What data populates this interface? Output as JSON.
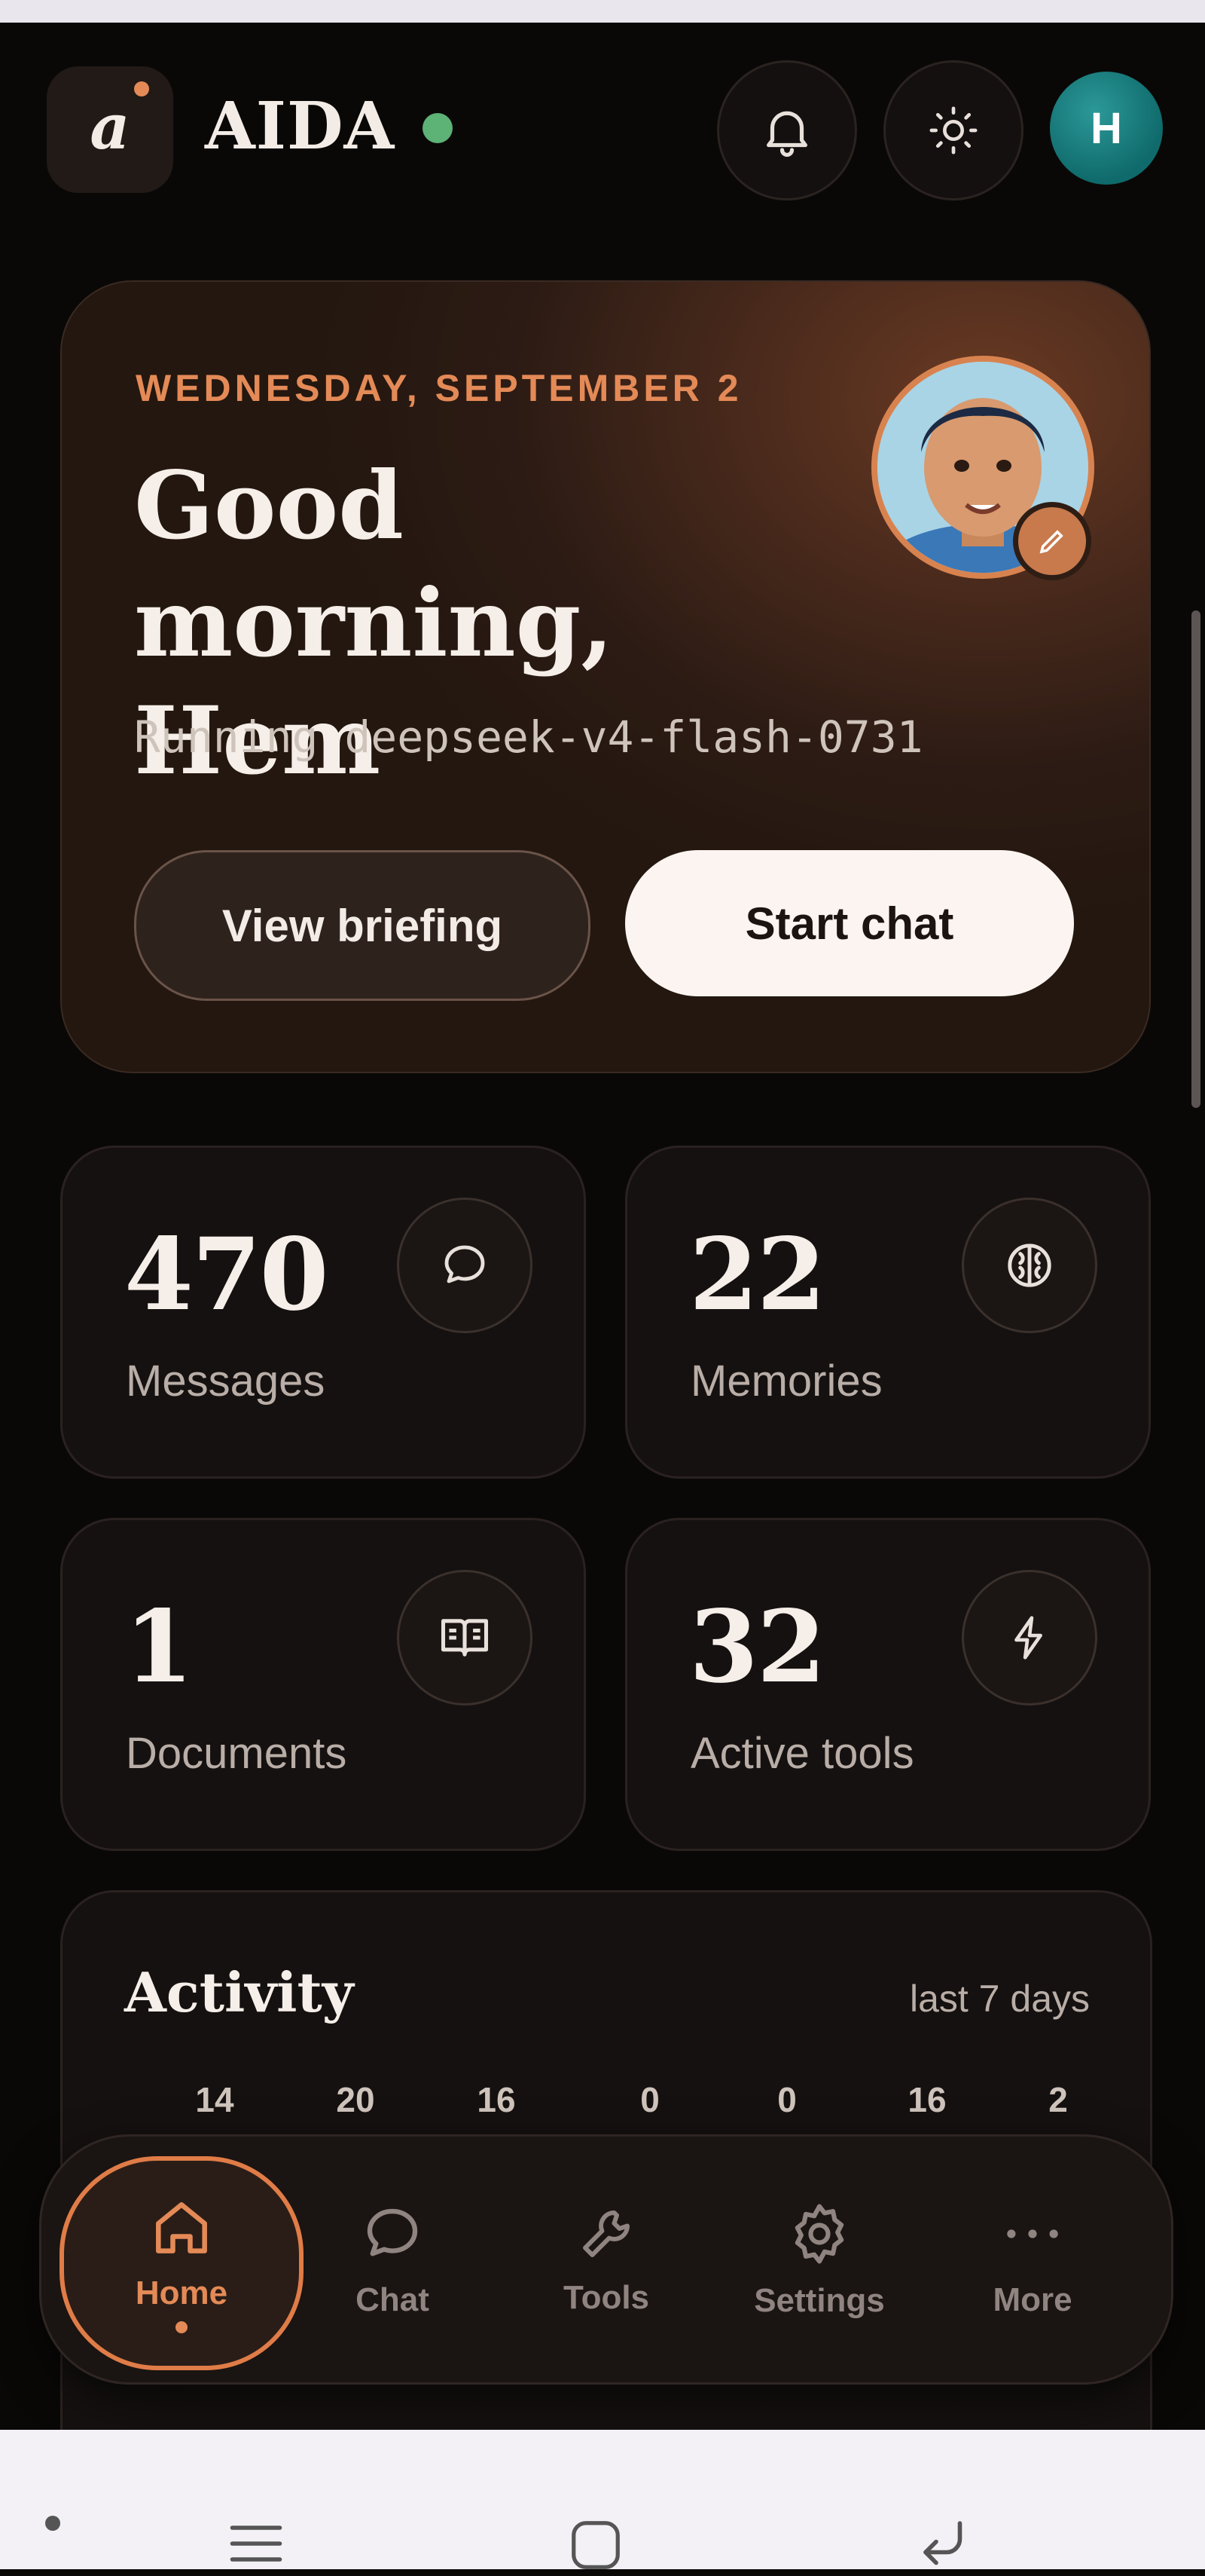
{
  "header": {
    "logo_letter": "a",
    "brand": "AIDA",
    "avatar_initial": "H",
    "icons": [
      "bell-icon",
      "sun-icon"
    ]
  },
  "hero": {
    "date": "WEDNESDAY, SEPTEMBER 2",
    "greeting_line1": "Good morning,",
    "greeting_line2": "Hem",
    "model_text": "Running deepseek-v4-flash-0731",
    "view_briefing": "View briefing",
    "start_chat": "Start chat"
  },
  "stats": [
    {
      "value": "470",
      "label": "Messages",
      "icon": "chat-bubble-icon"
    },
    {
      "value": "22",
      "label": "Memories",
      "icon": "brain-icon"
    },
    {
      "value": "1",
      "label": "Documents",
      "icon": "book-icon"
    },
    {
      "value": "32",
      "label": "Active tools",
      "icon": "lightning-icon"
    }
  ],
  "activity": {
    "title": "Activity",
    "range": "last 7 days",
    "values": [
      "14",
      "20",
      "16",
      "0",
      "0",
      "16",
      "2"
    ]
  },
  "nav": {
    "items": [
      "Home",
      "Chat",
      "Tools",
      "Settings",
      "More"
    ],
    "active": "Home"
  },
  "colors": {
    "accent": "#e48a57",
    "online": "#5db275",
    "background": "#0a0807",
    "avatar": "#0f6a6b"
  }
}
